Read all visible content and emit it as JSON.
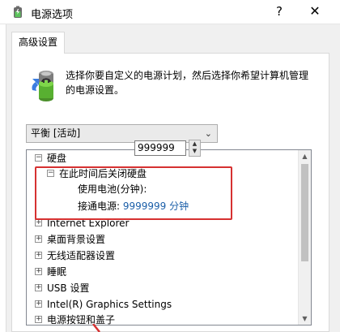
{
  "window": {
    "title": "电源选项",
    "help_label": "?",
    "close_label": "✕"
  },
  "tab": {
    "label": "高级设置"
  },
  "description": "选择你要自定义的电源计划，然后选择你希望计算机管理的电源设置。",
  "plan_select": {
    "value": "平衡 [活动]"
  },
  "tree": {
    "items": [
      {
        "label": "硬盘",
        "expanded": true
      },
      {
        "label": "在此时间后关闭硬盘",
        "expanded": true
      },
      {
        "label": "使用电池(分钟):",
        "value": "999999"
      },
      {
        "label": "接通电源:",
        "value": "9999999 分钟"
      },
      {
        "label": "Internet Explorer"
      },
      {
        "label": "桌面背景设置"
      },
      {
        "label": "无线适配器设置"
      },
      {
        "label": "睡眠"
      },
      {
        "label": "USB 设置"
      },
      {
        "label": "Intel(R) Graphics Settings"
      },
      {
        "label": "电源按钮和盖子"
      }
    ]
  },
  "colors": {
    "highlight_frame": "#d63131",
    "link_blue": "#1a5ea8"
  },
  "icons": {
    "title": "battery-power-icon",
    "plan": "battery-power-icon"
  }
}
